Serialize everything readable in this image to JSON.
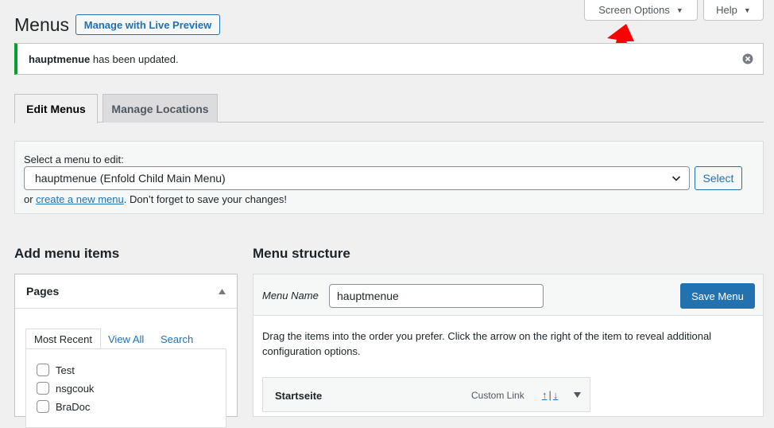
{
  "screen_meta": {
    "screen_options_label": "Screen Options",
    "help_label": "Help"
  },
  "header": {
    "title": "Menus",
    "live_preview_label": "Manage with Live Preview"
  },
  "notice": {
    "menu_name": "hauptmenue",
    "message": " has been updated."
  },
  "tabs": {
    "edit": "Edit Menus",
    "locations": "Manage Locations"
  },
  "select_menu": {
    "label": "Select a menu to edit:",
    "selected": "hauptmenue (Enfold Child Main Menu)",
    "button": "Select",
    "prefix": "or ",
    "create_link": "create a new menu",
    "suffix": ". Don’t forget to save your changes!"
  },
  "add_items": {
    "heading": "Add menu items",
    "box_title": "Pages",
    "tabs": [
      "Most Recent",
      "View All",
      "Search"
    ],
    "pages": [
      "Test",
      "nsgcouk",
      "BraDoc"
    ]
  },
  "structure": {
    "heading": "Menu structure",
    "menu_name_label": "Menu Name",
    "menu_name_value": "hauptmenue",
    "save_label": "Save Menu",
    "instructions": "Drag the items into the order you prefer. Click the arrow on the right of the item to reveal additional configuration options.",
    "items": [
      {
        "title": "Startseite",
        "type": "Custom Link",
        "up": "↑",
        "down": "↓"
      }
    ]
  },
  "colors": {
    "accent": "#2271b1",
    "success": "#00a32a",
    "annotation_arrow": "#ff0000"
  }
}
